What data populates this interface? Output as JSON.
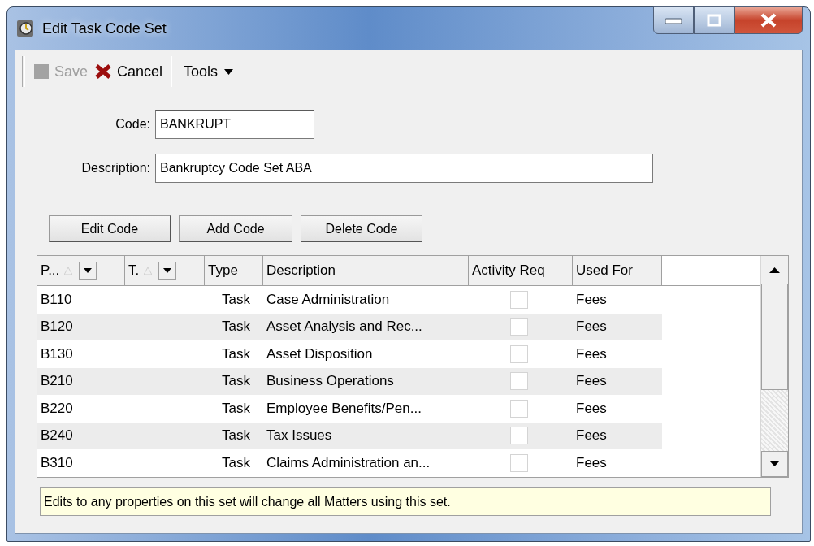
{
  "window": {
    "title": "Edit Task Code Set"
  },
  "toolbar": [
    {
      "kind": "save",
      "label": "Save",
      "disabled": true
    },
    {
      "kind": "cancel",
      "label": "Cancel",
      "disabled": false
    },
    {
      "kind": "menu",
      "label": "Tools"
    }
  ],
  "form": {
    "code": {
      "label": "Code:",
      "value": "BANKRUPT"
    },
    "description": {
      "label": "Description:",
      "value": "Bankruptcy Code Set ABA"
    }
  },
  "buttons": [
    "Edit Code",
    "Add Code",
    "Delete Code"
  ],
  "table": {
    "columns": [
      {
        "label": "P...",
        "kind": "filter"
      },
      {
        "label": "T.",
        "kind": "filter"
      },
      {
        "label": "Type",
        "kind": "plain"
      },
      {
        "label": "Description",
        "kind": "plain"
      },
      {
        "label": "Activity Req",
        "kind": "plain"
      },
      {
        "label": "Used For",
        "kind": "plain"
      }
    ],
    "rows": [
      {
        "code": "B110",
        "type": "Task",
        "description": "Case Administration",
        "activity_req": false,
        "used_for": "Fees"
      },
      {
        "code": "B120",
        "type": "Task",
        "description": "Asset Analysis and Rec...",
        "activity_req": false,
        "used_for": "Fees"
      },
      {
        "code": "B130",
        "type": "Task",
        "description": "Asset Disposition",
        "activity_req": false,
        "used_for": "Fees"
      },
      {
        "code": "B210",
        "type": "Task",
        "description": "Business Operations",
        "activity_req": false,
        "used_for": "Fees"
      },
      {
        "code": "B220",
        "type": "Task",
        "description": "Employee Benefits/Pen...",
        "activity_req": false,
        "used_for": "Fees"
      },
      {
        "code": "B240",
        "type": "Task",
        "description": "Tax Issues",
        "activity_req": false,
        "used_for": "Fees"
      },
      {
        "code": "B310",
        "type": "Task",
        "description": "Claims Administration an...",
        "activity_req": false,
        "used_for": "Fees"
      }
    ]
  },
  "status_bar": "Edits to any properties on this set will change all Matters using this set."
}
